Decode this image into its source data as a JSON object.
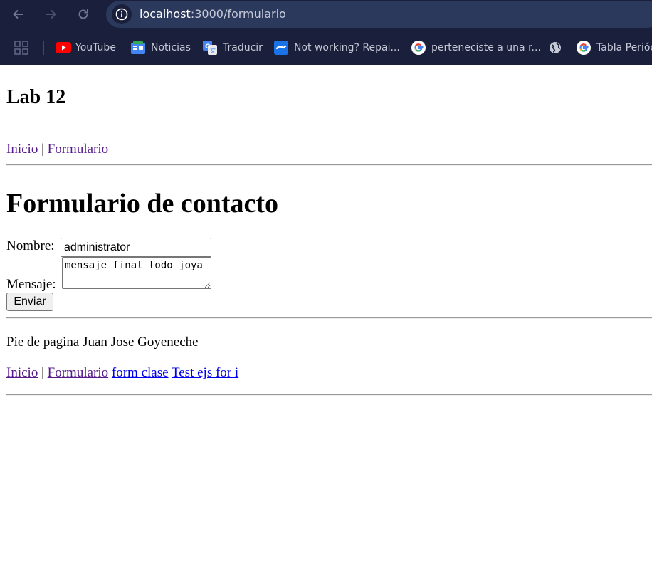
{
  "browser": {
    "url_host": "localhost",
    "url_path": ":3000/formulario",
    "bookmarks": [
      {
        "label": "YouTube",
        "icon": "youtube-icon"
      },
      {
        "label": "Noticias",
        "icon": "google-news-icon"
      },
      {
        "label": "Traducir",
        "icon": "google-translate-icon"
      },
      {
        "label": "Not working? Repai...",
        "icon": "wrench-icon"
      },
      {
        "label": "perteneciste a una r...",
        "icon": "google-icon"
      },
      {
        "label": "",
        "icon": "globe-icon"
      },
      {
        "label": "Tabla Periód",
        "icon": "google-icon"
      }
    ]
  },
  "header": {
    "title": "Lab 12",
    "nav": {
      "inicio": "Inicio",
      "sep": "|",
      "formulario": "Formulario"
    }
  },
  "main": {
    "title": "Formulario de contacto",
    "form": {
      "nombre_label": "Nombre:",
      "nombre_value": "administrator",
      "mensaje_label": "Mensaje:",
      "mensaje_value": "mensaje final todo joya",
      "submit_label": "Enviar"
    }
  },
  "footer": {
    "text": "Pie de pagina Juan Jose Goyeneche",
    "links": {
      "inicio": "Inicio",
      "sep": "|",
      "formulario": "Formulario",
      "form_clase": "form clase",
      "test_ejs": "Test ejs for i"
    }
  },
  "colors": {
    "chrome_bg": "#1a1f3c",
    "omnibox_bg": "#2b3a5c",
    "visited_link": "#551a8b",
    "unvisited_link": "#0000ee"
  }
}
